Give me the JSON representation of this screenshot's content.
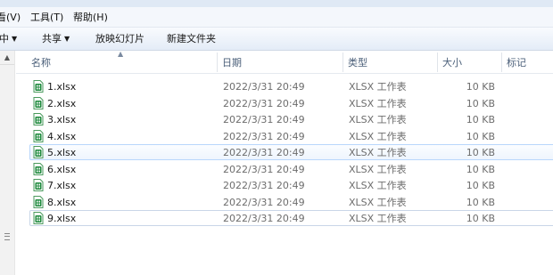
{
  "menu": [
    {
      "label": "看(V)",
      "name": "menu-view"
    },
    {
      "label": "工具(T)",
      "name": "menu-tools"
    },
    {
      "label": "帮助(H)",
      "name": "menu-help"
    }
  ],
  "toolbar": {
    "include_label": "中",
    "share_label": "共享",
    "slideshow_label": "放映幻灯片",
    "new_folder_label": "新建文件夹"
  },
  "columns": {
    "name": "名称",
    "date": "日期",
    "type": "类型",
    "size": "大小",
    "tags": "标记"
  },
  "files": [
    {
      "name": "1.xlsx",
      "date": "2022/3/31 20:49",
      "type": "XLSX 工作表",
      "size": "10 KB"
    },
    {
      "name": "2.xlsx",
      "date": "2022/3/31 20:49",
      "type": "XLSX 工作表",
      "size": "10 KB"
    },
    {
      "name": "3.xlsx",
      "date": "2022/3/31 20:49",
      "type": "XLSX 工作表",
      "size": "10 KB"
    },
    {
      "name": "4.xlsx",
      "date": "2022/3/31 20:49",
      "type": "XLSX 工作表",
      "size": "10 KB"
    },
    {
      "name": "5.xlsx",
      "date": "2022/3/31 20:49",
      "type": "XLSX 工作表",
      "size": "10 KB"
    },
    {
      "name": "6.xlsx",
      "date": "2022/3/31 20:49",
      "type": "XLSX 工作表",
      "size": "10 KB"
    },
    {
      "name": "7.xlsx",
      "date": "2022/3/31 20:49",
      "type": "XLSX 工作表",
      "size": "10 KB"
    },
    {
      "name": "8.xlsx",
      "date": "2022/3/31 20:49",
      "type": "XLSX 工作表",
      "size": "10 KB"
    },
    {
      "name": "9.xlsx",
      "date": "2022/3/31 20:49",
      "type": "XLSX 工作表",
      "size": "10 KB"
    }
  ],
  "icons": {
    "file": "excel-file-icon",
    "dropdown": "chevron-down-icon",
    "sort": "sort-ascending-icon"
  },
  "colors": {
    "hover_border": "#b8d6fb",
    "excel_green": "#1e8a3c",
    "header_text": "#4c607a"
  }
}
